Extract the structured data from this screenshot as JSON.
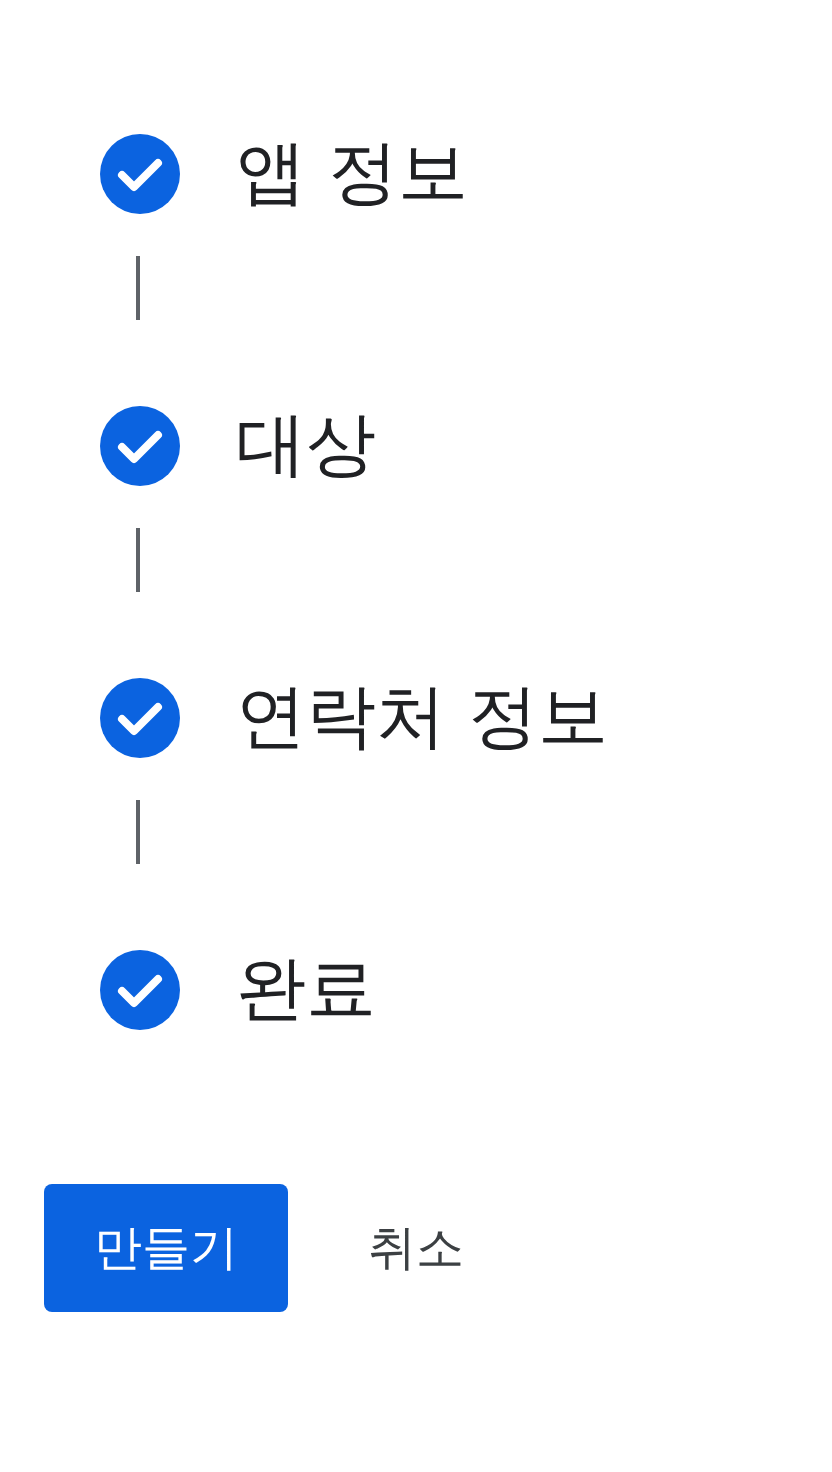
{
  "steps": [
    {
      "label": "앱 정보",
      "done": true
    },
    {
      "label": "대상",
      "done": true
    },
    {
      "label": "연락처 정보",
      "done": true
    },
    {
      "label": "완료",
      "done": true
    }
  ],
  "buttons": {
    "primary": "만들기",
    "secondary": "취소"
  }
}
